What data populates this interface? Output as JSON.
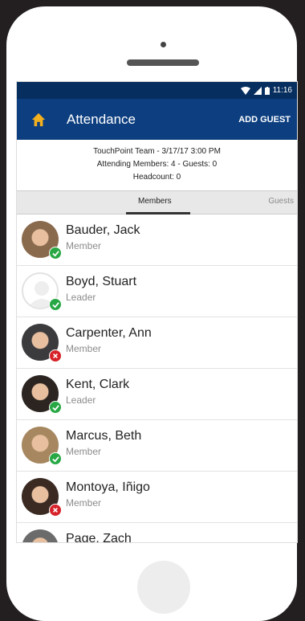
{
  "status": {
    "time": "11:16"
  },
  "app_bar": {
    "title": "Attendance",
    "add_guest_label": "ADD GUEST"
  },
  "info": {
    "line1": "TouchPoint Team - 3/17/17 3:00 PM",
    "line2": "Attending Members: 4 - Guests: 0",
    "line3": "Headcount: 0"
  },
  "tabs": {
    "members_label": "Members",
    "guests_label": "Guests",
    "active": "Members"
  },
  "members": [
    {
      "name": "Bauder, Jack",
      "role": "Member",
      "status": "attending",
      "avatar": "#8a6a4d"
    },
    {
      "name": "Boyd, Stuart",
      "role": "Leader",
      "status": "attending",
      "avatar": "placeholder"
    },
    {
      "name": "Carpenter, Ann",
      "role": "Member",
      "status": "absent",
      "avatar": "#3b3a3c"
    },
    {
      "name": "Kent, Clark",
      "role": "Leader",
      "status": "attending",
      "avatar": "#2b2420"
    },
    {
      "name": "Marcus, Beth",
      "role": "Member",
      "status": "attending",
      "avatar": "#a68760"
    },
    {
      "name": "Montoya, Iñigo",
      "role": "Member",
      "status": "absent",
      "avatar": "#3a2a22"
    },
    {
      "name": "Page, Zach",
      "role": "",
      "status": "",
      "avatar": "#6b6b6b"
    }
  ],
  "colors": {
    "status_bar": "#062e5e",
    "app_bar": "#0d3f80",
    "home_icon": "#f2b01e",
    "attending": "#27a844",
    "absent": "#d62228"
  }
}
